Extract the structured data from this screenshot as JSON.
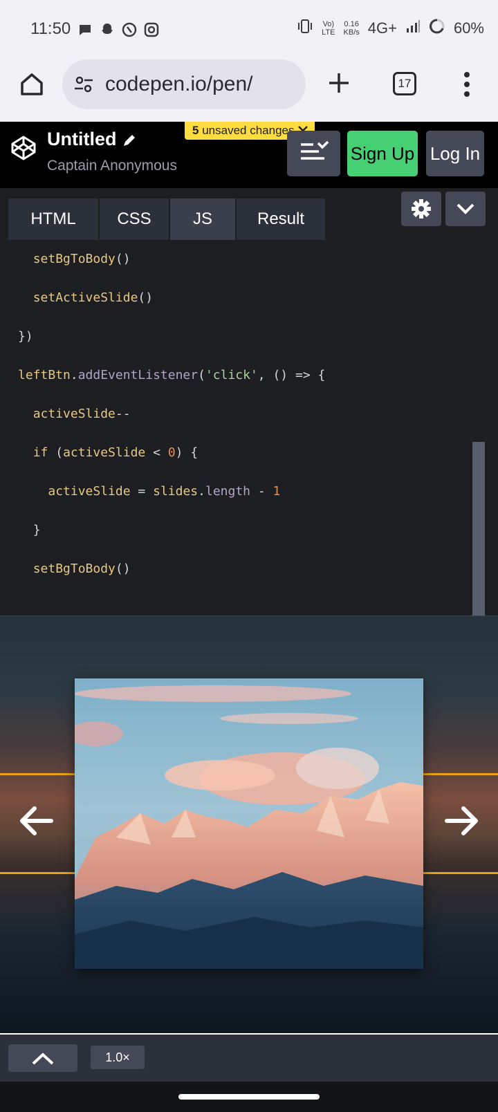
{
  "status_bar": {
    "time": "11:50",
    "network_top": "Vo)",
    "network_bottom": "LTE",
    "speed_top": "0.16",
    "speed_bottom": "KB/s",
    "signal": "4G+",
    "battery": "60%"
  },
  "browser": {
    "url": "codepen.io/pen/",
    "tab_count": "17"
  },
  "codepen": {
    "title": "Untitled",
    "author": "Captain Anonymous",
    "unsaved_count": "5",
    "unsaved_text": "unsaved changes",
    "signup_label": "Sign Up",
    "login_label": "Log In"
  },
  "editor": {
    "tabs": [
      {
        "label": "HTML",
        "active": false
      },
      {
        "label": "CSS",
        "active": false
      },
      {
        "label": "JS",
        "active": true
      },
      {
        "label": "Result",
        "active": false
      }
    ]
  },
  "bottom_bar": {
    "zoom": "1.0×"
  },
  "colors": {
    "accent_green": "#47cf73",
    "unsaved_yellow": "#ffdd40",
    "slider_gold": "#e8a317"
  },
  "icons": [
    "home-icon",
    "tune-icon",
    "plus-icon",
    "tabs-icon",
    "more-vert-icon",
    "codepen-logo-icon",
    "pencil-icon",
    "close-icon",
    "layout-icon",
    "gear-icon",
    "chevron-down-icon",
    "arrow-left-icon",
    "arrow-right-icon",
    "chevron-up-icon"
  ]
}
